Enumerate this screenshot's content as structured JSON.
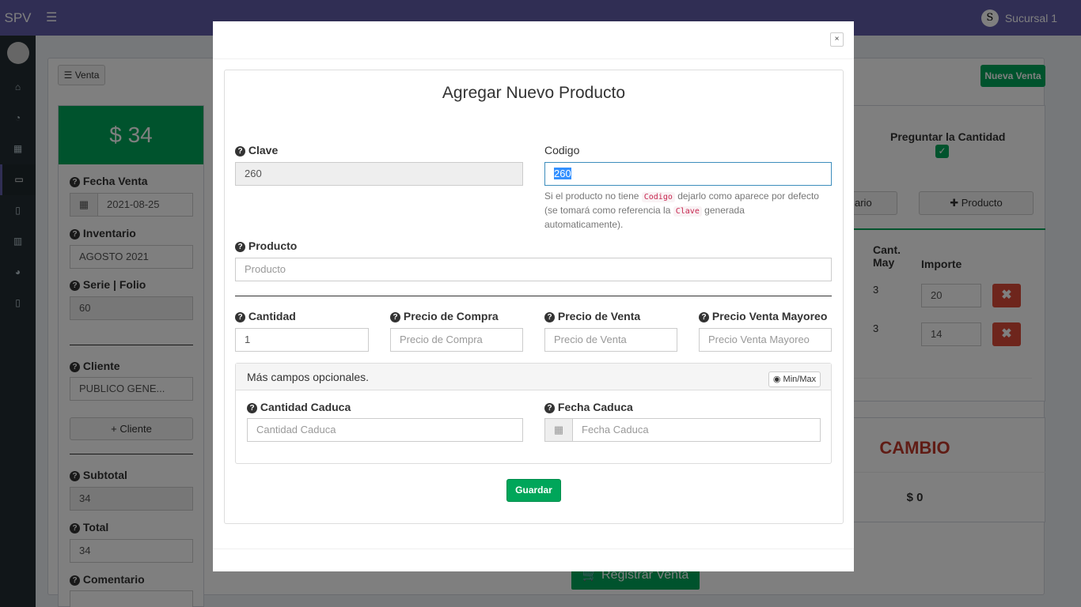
{
  "app": {
    "brand": "SPV",
    "sucursal": "Sucursal 1",
    "logo_letter": "S"
  },
  "sidebar": {
    "icons": [
      "user-avatar",
      "home-icon",
      "dashboard-icon",
      "grid-icon",
      "money-icon",
      "file-icon",
      "bar-chart-icon",
      "pie-chart-icon",
      "file-icon"
    ]
  },
  "toolbar": {
    "venta_label": "Venta",
    "nueva_venta": "Nueva Venta"
  },
  "left": {
    "total": "$ 34",
    "fecha_label": "Fecha Venta",
    "fecha": "2021-08-25",
    "inventario_label": "Inventario",
    "inventario": "AGOSTO 2021",
    "serie_label": "Serie | Folio",
    "serie": "60",
    "cliente_label": "Cliente",
    "cliente": "PUBLICO GENE...",
    "cliente_btn": "Cliente",
    "subtotal_label": "Subtotal",
    "subtotal": "34",
    "total_label": "Total",
    "total_val": "34",
    "comentario_label": "Comentario"
  },
  "right": {
    "preguntar": "Preguntar la Cantidad",
    "tab_partial": "ario",
    "producto_btn": "Producto",
    "col_cant": "Cant.",
    "col_may": "May",
    "col_importe": "Importe",
    "rows": [
      {
        "cant": "3",
        "importe": "20"
      },
      {
        "cant": "3",
        "importe": "14"
      }
    ],
    "cambio_label": "CAMBIO",
    "cambio": "$ 0",
    "registrar": "Registrar Venta"
  },
  "modal": {
    "close": "×",
    "title": "Agregar Nuevo Producto",
    "clave_label": "Clave",
    "clave": "260",
    "codigo_label": "Codigo",
    "codigo": "260",
    "help_1": "Si el producto no tiene ",
    "help_code1": "Codigo",
    "help_2": " dejarlo como aparece por defecto (se tomará como referencia la ",
    "help_code2": "Clave",
    "help_3": " generada automaticamente).",
    "producto_label": "Producto",
    "producto_ph": "Producto",
    "cantidad_label": "Cantidad",
    "cantidad": "1",
    "pcompra_label": "Precio de Compra",
    "pcompra_ph": "Precio de Compra",
    "pventa_label": "Precio de Venta",
    "pventa_ph": "Precio de Venta",
    "pmayoreo_label": "Precio Venta Mayoreo",
    "pmayoreo_ph": "Precio Venta Mayoreo",
    "opcionales": "Más campos opcionales.",
    "minmax": "Min/Max",
    "ccaduca_label": "Cantidad Caduca",
    "ccaduca_ph": "Cantidad Caduca",
    "fcaduca_label": "Fecha Caduca",
    "fcaduca_ph": "Fecha Caduca",
    "guardar": "Guardar"
  },
  "colors": {
    "topbar": "#605ca8",
    "sidebar": "#222d32",
    "green": "#00a65a",
    "red": "#dd4b39"
  }
}
